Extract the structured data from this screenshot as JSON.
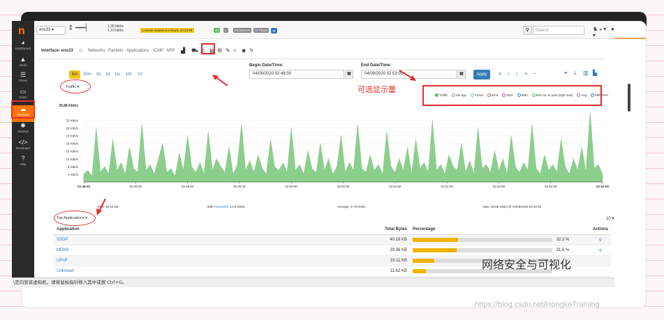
{
  "header": {
    "interface_select": "ens33",
    "speed_up": "1.30 kbit/s",
    "speed_down": "1.10 kbit/s",
    "license": "License expires in 6 Days, 10:13:48",
    "badges": [
      "24",
      "2",
      "22 Devices",
      "17 Flows"
    ],
    "search_placeholder": "Search"
  },
  "sidebar": {
    "items": [
      {
        "icon": "dashboard-icon",
        "glyph": "◕",
        "label": "Dashboard"
      },
      {
        "icon": "alerts-icon",
        "glyph": "▲",
        "label": "Alerts"
      },
      {
        "icon": "flows-icon",
        "glyph": "☰",
        "label": "Flows"
      },
      {
        "icon": "hosts-icon",
        "glyph": "▭",
        "label": "Hosts"
      },
      {
        "icon": "interface-icon",
        "glyph": "☁",
        "label": "Interface"
      },
      {
        "icon": "settings-icon",
        "glyph": "✱",
        "label": "Settings"
      },
      {
        "icon": "developer-icon",
        "glyph": "</>",
        "label": "Developer"
      },
      {
        "icon": "help-icon",
        "glyph": "?",
        "label": "Help"
      }
    ]
  },
  "iface_bar": {
    "title": "Interface: ens33",
    "nav": [
      "Networks",
      "Packets",
      "Applications",
      "ICMP",
      "ARP"
    ]
  },
  "time": {
    "ranges": [
      "5m",
      "30m",
      "1h",
      "1d",
      "1w",
      "1M",
      "1Y"
    ],
    "active": "5m",
    "begin_label": "Begin Date/Time:",
    "begin_value": "04/09/2020 02:48:00",
    "end_label": "End Date/Time:",
    "end_value": "04/09/2020 02:53:00",
    "apply": "Apply"
  },
  "traffic_dropdown": "Traffic",
  "annotation": "可选显示量",
  "legend": [
    "Traffic",
    "5m ago",
    "Trend",
    "Ema",
    "SMA",
    "95th",
    "RSI cur vs past (right axis)",
    "Avg",
    "95th Perc"
  ],
  "legend_colors": [
    "#5cb85c",
    "#999999",
    "#5bc0de",
    "#d9534f",
    "#9b59b6",
    "#337ab7",
    "#5cb85c",
    "#888888",
    "#337ab7"
  ],
  "chart_data": {
    "type": "area",
    "ylabel_top": "36.88 Kbit/s",
    "y_ticks": [
      "32 Kbit/s",
      "28 Kbit/s",
      "24 Kbit/s",
      "20 Kbit/s",
      "16 Kbit/s",
      "12 Kbit/s",
      "8 Kbit/s",
      "4 Kbit/s"
    ],
    "ylim": [
      0,
      36.88
    ],
    "x_ticks": [
      "02:48:00",
      "02:48:30",
      "02:49:00",
      "02:49:30",
      "02:50:00",
      "02:50:30",
      "02:51:00",
      "02:51:30",
      "02:52:00",
      "02:52:30",
      "02:53:00"
    ],
    "series": [
      {
        "name": "Traffic",
        "color": "#8ccf8c",
        "values": [
          4,
          6,
          3,
          28,
          5,
          8,
          4,
          22,
          6,
          10,
          4,
          18,
          7,
          5,
          30,
          6,
          9,
          4,
          12,
          20,
          5,
          7,
          3,
          15,
          6,
          24,
          8,
          5,
          10,
          4,
          26,
          6,
          12,
          8,
          5,
          18,
          4,
          9,
          30,
          6,
          11,
          5,
          14,
          7,
          4,
          22,
          8,
          6,
          10,
          5,
          28,
          6,
          9,
          4,
          16,
          7,
          5,
          20,
          6,
          12,
          4,
          8,
          24,
          5,
          10,
          6,
          30,
          7,
          5,
          14,
          6,
          9,
          4,
          26,
          8,
          5,
          12,
          6,
          18,
          4,
          22,
          7,
          10,
          5,
          32,
          6,
          9,
          4,
          14,
          8,
          6,
          20,
          5,
          11,
          4,
          28,
          7,
          9,
          5,
          16,
          6,
          12,
          4,
          24,
          8,
          5,
          10,
          6,
          30,
          7,
          4,
          14,
          6,
          9,
          5,
          22,
          8,
          4,
          12,
          6,
          18,
          5,
          36,
          7,
          9,
          4
        ]
      }
    ]
  },
  "stats": {
    "total": "Total: 38.62 KB",
    "p95_prefix": "95th",
    "p95_link": "Percentile",
    "p95_value": ": 13.5 Kbit/s",
    "avg": "Average: 3.79 Kbit/s",
    "max": "Max: 30.88 Kbit/s @ 04/09/2020 02:49:49"
  },
  "top_apps": {
    "dropdown": "Top Applications",
    "rows_per_page": "10",
    "headers": [
      "Application",
      "Total Bytes",
      "Percentage",
      "Actions"
    ],
    "rows": [
      {
        "app": "SSDP",
        "bytes": "40.19 KB",
        "pct": "32.3 %",
        "frac": 0.323
      },
      {
        "app": "MDNS",
        "bytes": "39.36 KB",
        "pct": "31.6 %",
        "frac": 0.316
      },
      {
        "app": "UPnP",
        "bytes": "19.11 KB",
        "pct": "",
        "frac": 0.153
      },
      {
        "app": "Unknown",
        "bytes": "11.62 KB",
        "pct": "",
        "frac": 0.093
      }
    ]
  },
  "statusbar": "\\定向到该虚拟机，请将鼠标指针移入其中或按 Ctrl+G。",
  "watermark": "网络安全与可视化",
  "watermark_url": "https://blog.csdn.net/HongkeTraining"
}
